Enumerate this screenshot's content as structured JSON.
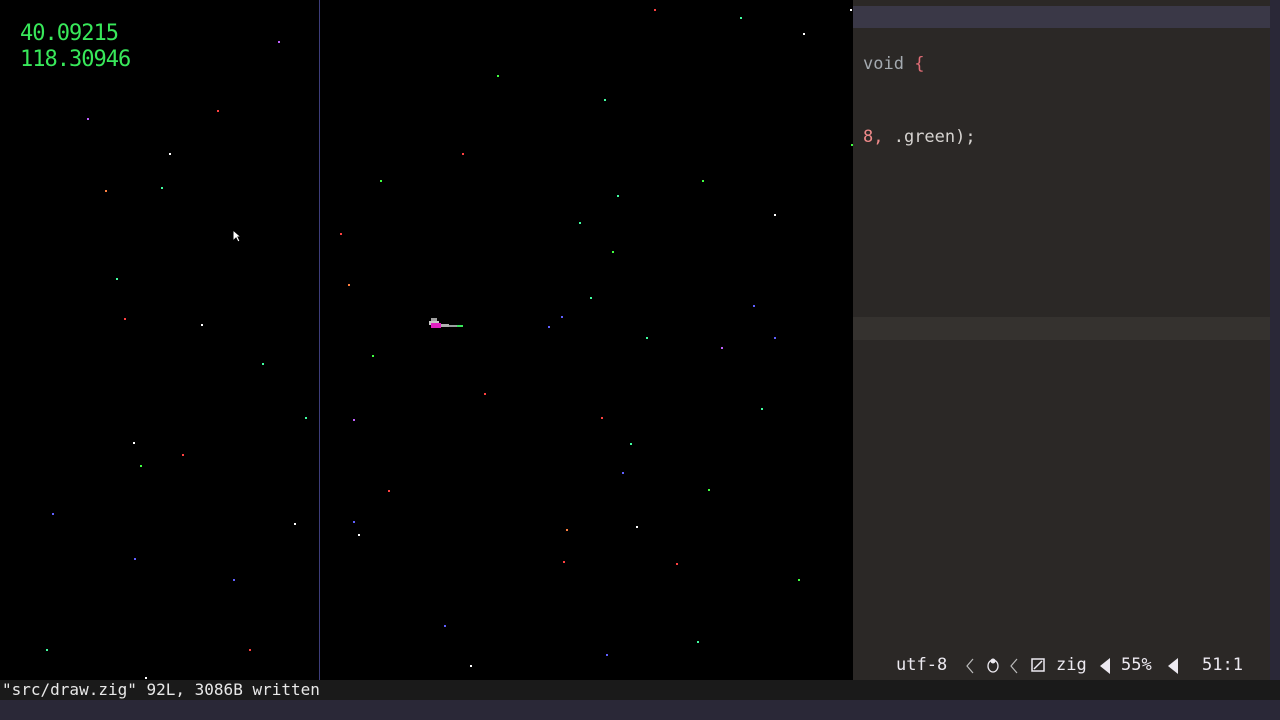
{
  "game": {
    "hud_x": "40.09215",
    "hud_y": "118.30946"
  },
  "editor": {
    "line1_text": "void",
    "line1_brace": "{",
    "line2_num": "8,",
    "line2_rest": " .green);"
  },
  "statusline": {
    "encoding": "utf-8",
    "filetype": "zig",
    "percent": "55%",
    "position": "51:1"
  },
  "cmdline": {
    "message": "\"src/draw.zig\" 92L, 3086B written"
  },
  "colors": {
    "hud": "#38e85a",
    "game_bg": "#000000",
    "editor_bg": "#2b2826",
    "accent_red": "#e06c75"
  },
  "icons": [
    "mouse-cursor-icon",
    "ship-sprite",
    "linux-penguin-icon",
    "git-branch-icon"
  ]
}
